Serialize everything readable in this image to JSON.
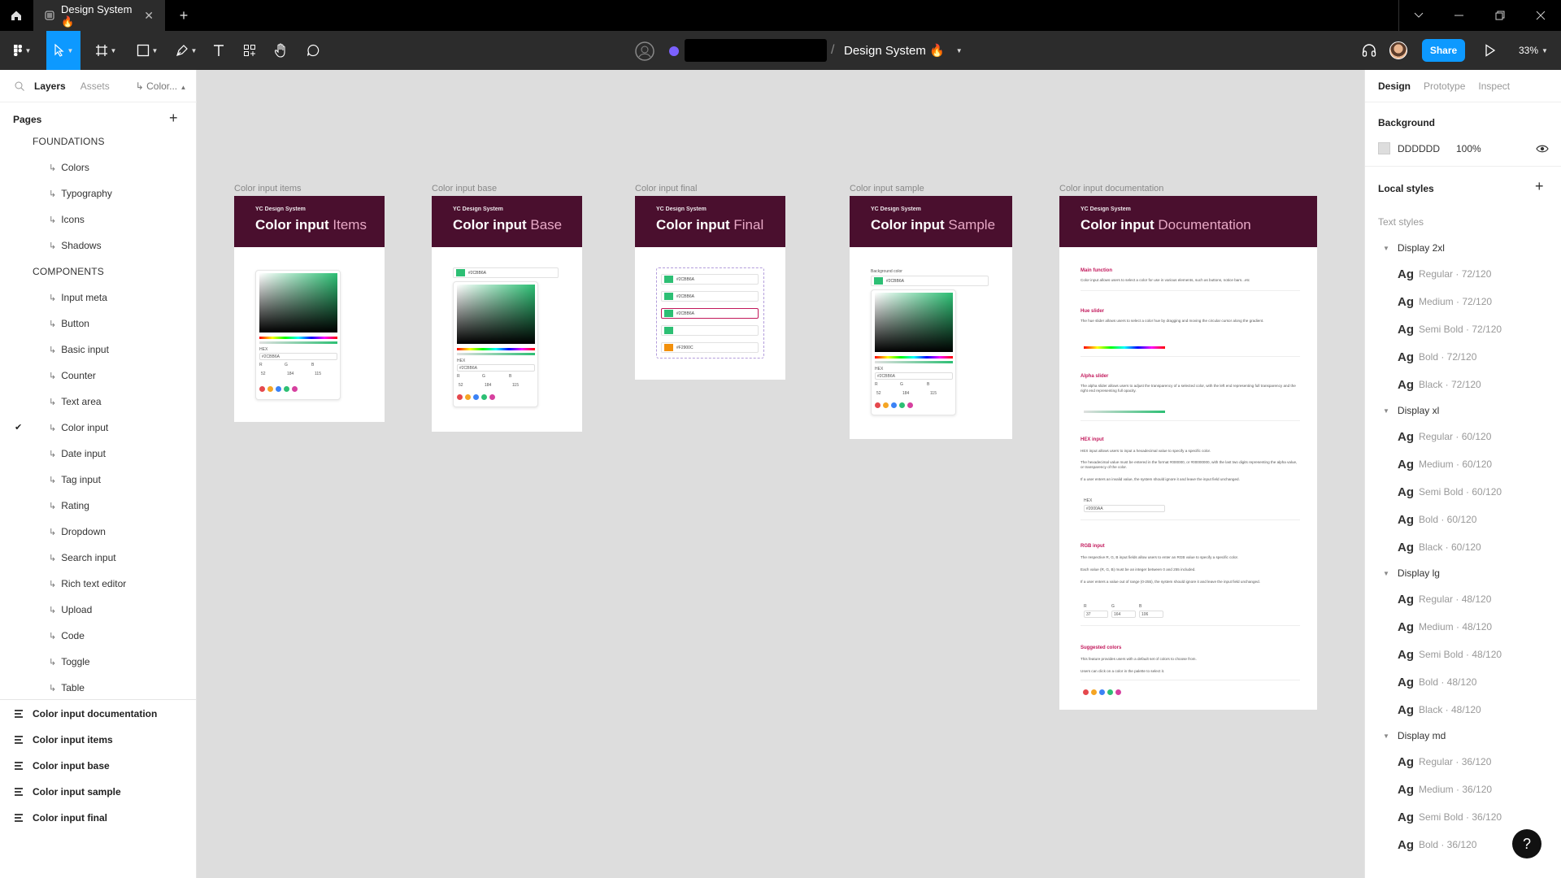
{
  "titlebar": {
    "tab_title": "Design System 🔥",
    "close": "✕",
    "new_tab": "+"
  },
  "toolbar": {
    "file_title": "Design System 🔥",
    "share_label": "Share",
    "zoom": "33%"
  },
  "left_panel": {
    "tabs": [
      "Layers",
      "Assets",
      "Color..."
    ],
    "pages_label": "Pages",
    "pages": [
      {
        "label": "FOUNDATIONS",
        "kind": "section"
      },
      {
        "label": "Colors",
        "kind": "item"
      },
      {
        "label": "Typography",
        "kind": "item"
      },
      {
        "label": "Icons",
        "kind": "item"
      },
      {
        "label": "Shadows",
        "kind": "item"
      },
      {
        "label": "COMPONENTS",
        "kind": "section"
      },
      {
        "label": "Input meta",
        "kind": "item"
      },
      {
        "label": "Button",
        "kind": "item"
      },
      {
        "label": "Basic input",
        "kind": "item"
      },
      {
        "label": "Counter",
        "kind": "item"
      },
      {
        "label": "Text area",
        "kind": "item"
      },
      {
        "label": "Color input",
        "kind": "item",
        "current": true
      },
      {
        "label": "Date input",
        "kind": "item"
      },
      {
        "label": "Tag input",
        "kind": "item"
      },
      {
        "label": "Rating",
        "kind": "item"
      },
      {
        "label": "Dropdown",
        "kind": "item"
      },
      {
        "label": "Search input",
        "kind": "item"
      },
      {
        "label": "Rich text editor",
        "kind": "item"
      },
      {
        "label": "Upload",
        "kind": "item"
      },
      {
        "label": "Code",
        "kind": "item"
      },
      {
        "label": "Toggle",
        "kind": "item"
      },
      {
        "label": "Table",
        "kind": "item"
      }
    ],
    "layers": [
      "Color input documentation",
      "Color input items",
      "Color input base",
      "Color input sample",
      "Color input final"
    ]
  },
  "right_panel": {
    "tabs": [
      "Design",
      "Prototype",
      "Inspect"
    ],
    "background_label": "Background",
    "background_hex": "DDDDDD",
    "background_opacity": "100%",
    "local_styles_label": "Local styles",
    "text_styles_label": "Text styles",
    "groups": [
      {
        "name": "Display 2xl",
        "styles": [
          "Regular · 72/120",
          "Medium · 72/120",
          "Semi Bold · 72/120",
          "Bold · 72/120",
          "Black · 72/120"
        ]
      },
      {
        "name": "Display xl",
        "styles": [
          "Regular · 60/120",
          "Medium · 60/120",
          "Semi Bold · 60/120",
          "Bold · 60/120",
          "Black · 60/120"
        ]
      },
      {
        "name": "Display lg",
        "styles": [
          "Regular · 48/120",
          "Medium · 48/120",
          "Semi Bold · 48/120",
          "Bold · 48/120",
          "Black · 48/120"
        ]
      },
      {
        "name": "Display md",
        "styles": [
          "Regular · 36/120",
          "Medium · 36/120",
          "Semi Bold · 36/120",
          "Bold · 36/120"
        ]
      }
    ],
    "style_sample": "Ag",
    "help": "?"
  },
  "canvas": {
    "brand": "YC Design System",
    "frames": [
      {
        "label": "Color input items",
        "title": "Color input",
        "accent": "Items"
      },
      {
        "label": "Color input base",
        "title": "Color input",
        "accent": "Base"
      },
      {
        "label": "Color input final",
        "title": "Color input",
        "accent": "Final"
      },
      {
        "label": "Color input sample",
        "title": "Color input",
        "accent": "Sample"
      },
      {
        "label": "Color input documentation",
        "title": "Color input",
        "accent": "Documentation"
      }
    ],
    "hex_value": "#2CBB6A",
    "hex_label": "HEX",
    "rgb_labels": [
      "R",
      "G",
      "B"
    ],
    "rgb_values": [
      "52",
      "184",
      "115"
    ],
    "background_color_label": "Background color",
    "suggested_colors": [
      "#e5484d",
      "#f5a524",
      "#3b82f6",
      "#2dbf74",
      "#d6409f"
    ],
    "final_rows": [
      "#2CBB6A",
      "#2CBB6A",
      "#2CBB6A",
      "",
      "#F2900C"
    ],
    "final_colors": [
      "#2dbf74",
      "#2dbf74",
      "#2dbf74",
      "#2dbf74",
      "#f2900c"
    ],
    "doc": {
      "main_title": "Main function",
      "main_text": "Color input allows users to select a color for use in various elements, such as buttons, notice bars...etc",
      "hue_title": "Hue slider",
      "hue_text": "The hue slider allows users to select a color hue by dragging and moving the circular cursor along the gradient.",
      "alpha_title": "Alpha slider",
      "alpha_text": "The alpha slider allows users to adjust the transparency of a selected color, with the left end representing full transparency and the right end representing full opacity.",
      "hex_title": "HEX input",
      "hex_text_1": "HEX input allows users to input a hexadecimal value to specify a specific color.",
      "hex_text_2": "The hexadecimal value must be entered in the format #000000, or #00000000, with the last two digits representing the alpha value, or transparency of the color.",
      "hex_text_3": "If a user enters an invalid value, the system should ignore it and leave the input field unchanged.",
      "hex_sample": "#2000AA",
      "rgb_title": "RGB input",
      "rgb_text_1": "The respective R, G, B input fields allow users to enter an RGB value to specify a specific color.",
      "rgb_text_2": "Each value (R, G, B) must be an integer between 0 and 255 included.",
      "rgb_text_3": "If a user enters a value out of range (0-255), the system should ignore it and leave the input field unchanged.",
      "rgb_sample": [
        "37",
        "164",
        "106"
      ],
      "suggested_title": "Suggested colors",
      "suggested_text_1": "This feature provides users with a default set of colors to choose from.",
      "suggested_text_2": "Users can click on a color in the palette to select it."
    }
  },
  "colors": {
    "accent": "#0d99ff",
    "header": "#4a0f2e",
    "canvas_bg": "#dddddd"
  }
}
